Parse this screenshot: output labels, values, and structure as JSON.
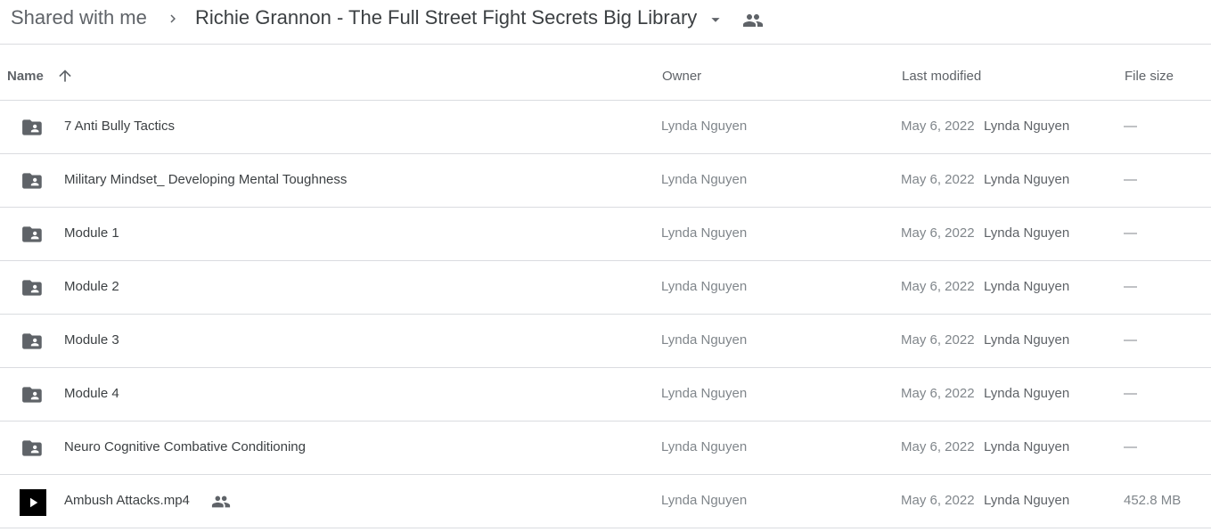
{
  "breadcrumb": {
    "root_label": "Shared with me",
    "current_folder": "Richie Grannon - The Full Street Fight Secrets Big Library"
  },
  "columns": {
    "name": "Name",
    "owner": "Owner",
    "last_modified": "Last modified",
    "file_size": "File size"
  },
  "rows": [
    {
      "name": "7 Anti Bully Tactics",
      "type": "shared-folder-icon",
      "owner": "Lynda Nguyen",
      "date": "May 6, 2022",
      "modified_by": "Lynda Nguyen",
      "size": "—"
    },
    {
      "name": "Military Mindset_ Developing Mental Toughness",
      "type": "shared-folder-icon",
      "owner": "Lynda Nguyen",
      "date": "May 6, 2022",
      "modified_by": "Lynda Nguyen",
      "size": "—"
    },
    {
      "name": "Module 1",
      "type": "shared-folder-icon",
      "owner": "Lynda Nguyen",
      "date": "May 6, 2022",
      "modified_by": "Lynda Nguyen",
      "size": "—"
    },
    {
      "name": "Module 2",
      "type": "shared-folder-icon",
      "owner": "Lynda Nguyen",
      "date": "May 6, 2022",
      "modified_by": "Lynda Nguyen",
      "size": "—"
    },
    {
      "name": "Module 3",
      "type": "shared-folder-icon",
      "owner": "Lynda Nguyen",
      "date": "May 6, 2022",
      "modified_by": "Lynda Nguyen",
      "size": "—"
    },
    {
      "name": "Module 4",
      "type": "shared-folder-icon",
      "owner": "Lynda Nguyen",
      "date": "May 6, 2022",
      "modified_by": "Lynda Nguyen",
      "size": "—"
    },
    {
      "name": "Neuro Cognitive Combative Conditioning",
      "type": "shared-folder-icon",
      "owner": "Lynda Nguyen",
      "date": "May 6, 2022",
      "modified_by": "Lynda Nguyen",
      "size": "—"
    },
    {
      "name": "Ambush Attacks.mp4",
      "type": "video-thumbnail",
      "shared": true,
      "owner": "Lynda Nguyen",
      "date": "May 6, 2022",
      "modified_by": "Lynda Nguyen",
      "size": "452.8 MB"
    }
  ],
  "colors": {
    "icon_grey": "#5f6368",
    "border": "#dadce0",
    "text_dark": "#3c4043",
    "text_muted": "#80868b"
  }
}
